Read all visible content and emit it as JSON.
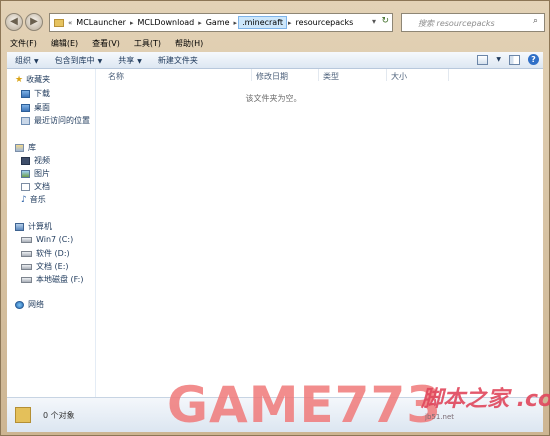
{
  "address": {
    "overflow": "«",
    "crumbs": [
      "MCLauncher",
      "MCLDownload",
      "Game",
      ".minecraft",
      "resourcepacks"
    ],
    "active_index": 3
  },
  "search": {
    "placeholder": "搜索 resourcepacks"
  },
  "menu": [
    "文件(F)",
    "编辑(E)",
    "查看(V)",
    "工具(T)",
    "帮助(H)"
  ],
  "toolbar": {
    "organize": "组织",
    "include_library": "包含到库中",
    "share": "共享",
    "new_folder": "新建文件夹",
    "help": "?"
  },
  "sidebar": {
    "favorites": {
      "label": "收藏夹",
      "items": [
        "下载",
        "桌面",
        "最近访问的位置"
      ]
    },
    "libraries": {
      "label": "库",
      "items": [
        "视频",
        "图片",
        "文档",
        "音乐"
      ]
    },
    "computer": {
      "label": "计算机",
      "items": [
        "Win7 (C:)",
        "软件 (D:)",
        "文档 (E:)",
        "本地磁盘 (F:)"
      ]
    },
    "network": {
      "label": "网络"
    }
  },
  "columns": {
    "name": "名称",
    "modified": "修改日期",
    "type": "类型",
    "size": "大小"
  },
  "empty_message": "该文件夹为空。",
  "status": {
    "count": "0 个对象"
  },
  "watermark": {
    "logo": "GAME773",
    "site": "脚本之家 .com",
    "sub": "jb51.net"
  },
  "colors": {
    "accent": "#1e395b",
    "window_frame": "#d9c4a4",
    "watermark_red": "#f07a7a"
  }
}
